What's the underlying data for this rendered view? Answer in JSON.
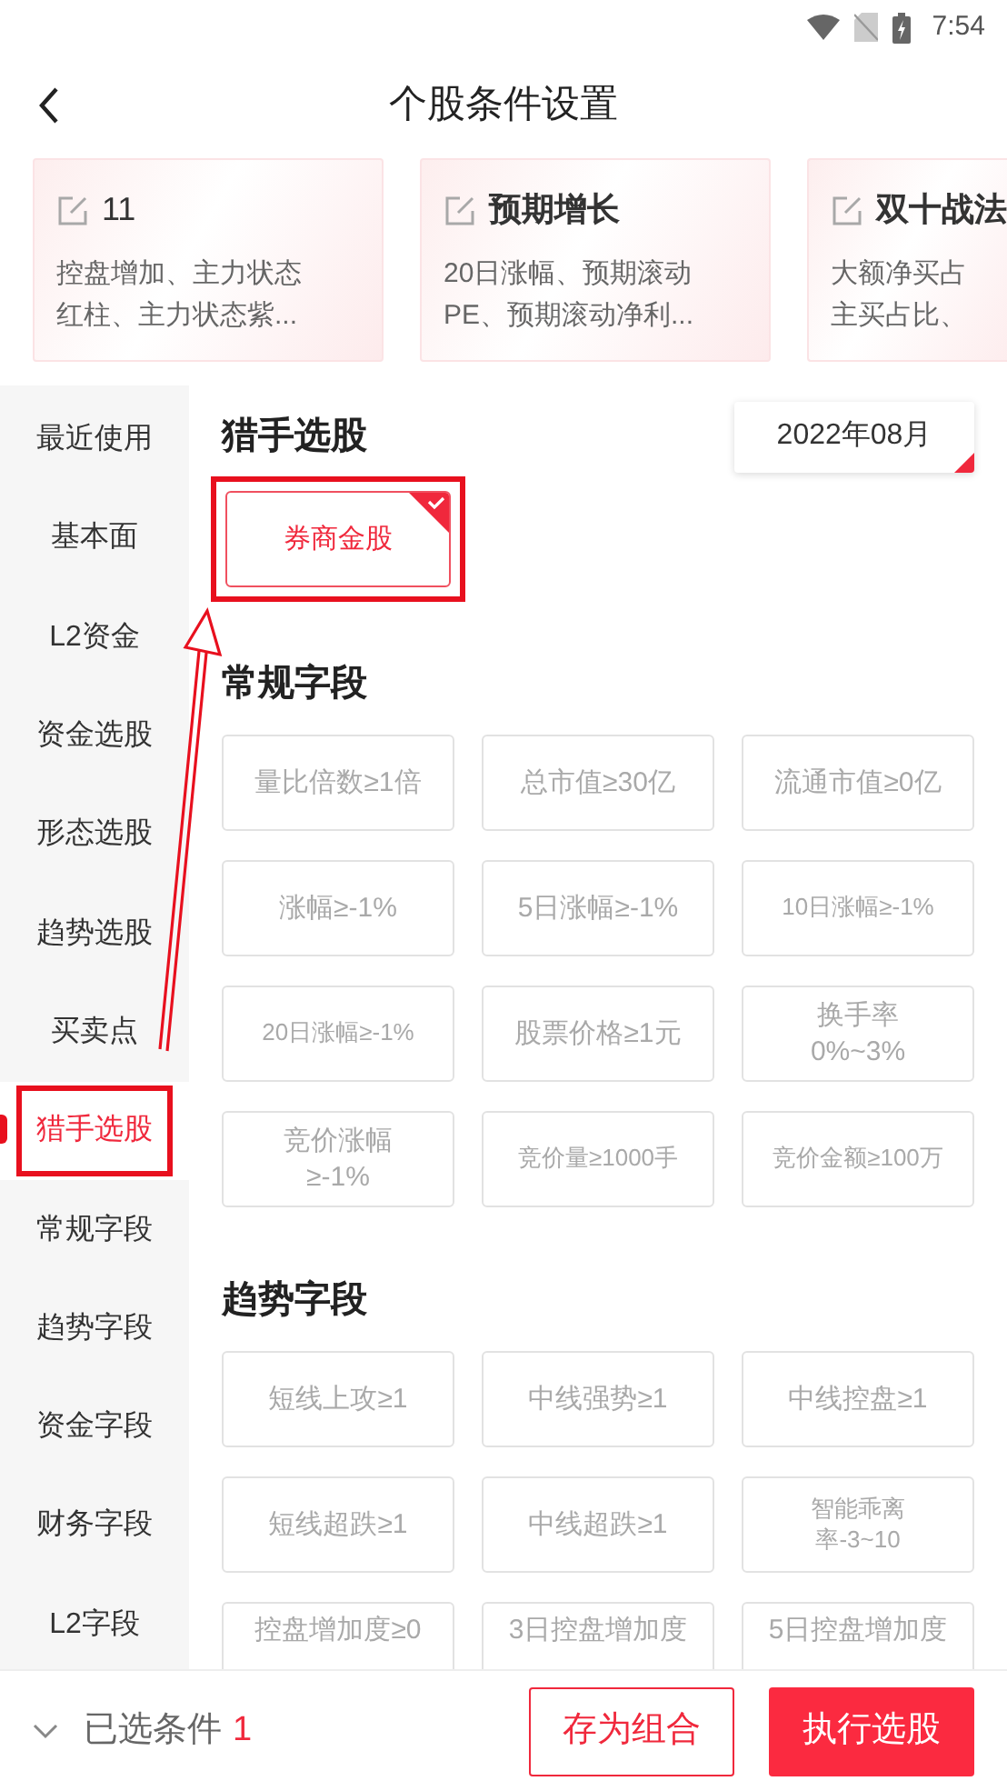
{
  "status_bar": {
    "time": "7:54"
  },
  "header": {
    "title": "个股条件设置"
  },
  "strategy_cards": [
    {
      "title": "11",
      "lines": [
        "控盘增加、主力状态",
        "红柱、主力状态紫..."
      ]
    },
    {
      "title": "预期增长",
      "lines": [
        "20日涨幅、预期滚动",
        "PE、预期滚动净利..."
      ]
    },
    {
      "title": "双十战法",
      "lines": [
        "大额净买占",
        "主买占比、"
      ]
    }
  ],
  "sidebar": {
    "items": [
      {
        "label": "最近使用",
        "selected": false,
        "highlighted": false
      },
      {
        "label": "基本面",
        "selected": false,
        "highlighted": false
      },
      {
        "label": "L2资金",
        "selected": false,
        "highlighted": false
      },
      {
        "label": "资金选股",
        "selected": false,
        "highlighted": false
      },
      {
        "label": "形态选股",
        "selected": false,
        "highlighted": false
      },
      {
        "label": "趋势选股",
        "selected": false,
        "highlighted": false
      },
      {
        "label": "买卖点",
        "selected": false,
        "highlighted": false
      },
      {
        "label": "猎手选股",
        "selected": true,
        "highlighted": true
      },
      {
        "label": "常规字段",
        "selected": false,
        "highlighted": false
      },
      {
        "label": "趋势字段",
        "selected": false,
        "highlighted": false
      },
      {
        "label": "资金字段",
        "selected": false,
        "highlighted": false
      },
      {
        "label": "财务字段",
        "selected": false,
        "highlighted": false
      },
      {
        "label": "L2字段",
        "selected": false,
        "highlighted": false
      }
    ]
  },
  "sections": [
    {
      "title": "猎手选股",
      "date_picker": "2022年08月",
      "chips": [
        {
          "lines": [
            "券商金股"
          ],
          "selected": true,
          "highlighted": true
        }
      ]
    },
    {
      "title": "常规字段",
      "chips": [
        {
          "lines": [
            "量比倍数≥1倍"
          ],
          "selected": false,
          "highlighted": false
        },
        {
          "lines": [
            "总市值≥30亿"
          ],
          "selected": false,
          "highlighted": false
        },
        {
          "lines": [
            "流通市值≥0亿"
          ],
          "selected": false,
          "highlighted": false
        },
        {
          "lines": [
            "涨幅≥-1%"
          ],
          "selected": false,
          "highlighted": false
        },
        {
          "lines": [
            "5日涨幅≥-1%"
          ],
          "selected": false,
          "highlighted": false
        },
        {
          "lines": [
            "10日涨幅≥-1%"
          ],
          "selected": false,
          "highlighted": false
        },
        {
          "lines": [
            "20日涨幅≥-1%"
          ],
          "selected": false,
          "highlighted": false
        },
        {
          "lines": [
            "股票价格≥1元"
          ],
          "selected": false,
          "highlighted": false
        },
        {
          "lines": [
            "换手率",
            "0%~3%"
          ],
          "selected": false,
          "highlighted": false
        },
        {
          "lines": [
            "竞价涨幅",
            "≥-1%"
          ],
          "selected": false,
          "highlighted": false
        },
        {
          "lines": [
            "竞价量≥1000手"
          ],
          "selected": false,
          "highlighted": false
        },
        {
          "lines": [
            "竞价金额≥100万"
          ],
          "selected": false,
          "highlighted": false
        }
      ]
    },
    {
      "title": "趋势字段",
      "chips": [
        {
          "lines": [
            "短线上攻≥1"
          ],
          "selected": false,
          "highlighted": false
        },
        {
          "lines": [
            "中线强势≥1"
          ],
          "selected": false,
          "highlighted": false
        },
        {
          "lines": [
            "中线控盘≥1"
          ],
          "selected": false,
          "highlighted": false
        },
        {
          "lines": [
            "短线超跌≥1"
          ],
          "selected": false,
          "highlighted": false
        },
        {
          "lines": [
            "中线超跌≥1"
          ],
          "selected": false,
          "highlighted": false
        },
        {
          "lines": [
            "智能乖离",
            "率-3~10"
          ],
          "selected": false,
          "highlighted": false
        },
        {
          "lines": [
            "控盘增加度≥0"
          ],
          "selected": false,
          "highlighted": false,
          "cut_off": true
        },
        {
          "lines": [
            "3日控盘增加度"
          ],
          "selected": false,
          "highlighted": false,
          "cut_off": true
        },
        {
          "lines": [
            "5日控盘增加度"
          ],
          "selected": false,
          "highlighted": false,
          "cut_off": true
        }
      ]
    }
  ],
  "footer": {
    "label": "已选条件",
    "count": "1",
    "buttons": [
      {
        "label": "存为组合",
        "kind": "outline"
      },
      {
        "label": "执行选股",
        "kind": "primary"
      }
    ]
  },
  "annotation": {
    "arrow": true
  }
}
